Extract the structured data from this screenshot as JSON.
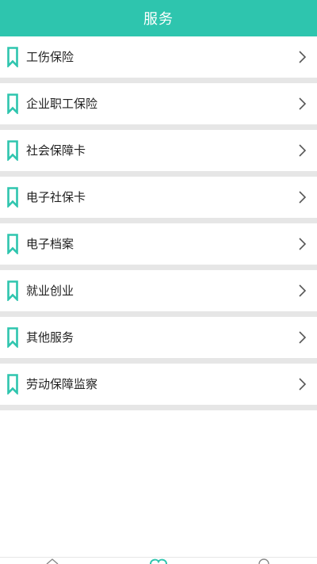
{
  "header": {
    "title": "服务"
  },
  "theme": {
    "accent": "#2ec5ae",
    "separator": "#e6e6e6",
    "text": "#222222",
    "chevron": "#555555"
  },
  "items": [
    {
      "label": "工伤保险",
      "icon": "bookmark-icon"
    },
    {
      "label": "企业职工保险",
      "icon": "bookmark-icon"
    },
    {
      "label": "社会保障卡",
      "icon": "bookmark-icon"
    },
    {
      "label": "电子社保卡",
      "icon": "bookmark-icon"
    },
    {
      "label": "电子档案",
      "icon": "bookmark-icon"
    },
    {
      "label": "就业创业",
      "icon": "bookmark-icon"
    },
    {
      "label": "其他服务",
      "icon": "bookmark-icon"
    },
    {
      "label": "劳动保障监察",
      "icon": "bookmark-icon"
    }
  ],
  "tabbar": {
    "tabs": [
      {
        "icon": "home-icon",
        "active": false
      },
      {
        "icon": "service-heart-icon",
        "active": true
      },
      {
        "icon": "user-icon",
        "active": false
      }
    ]
  }
}
